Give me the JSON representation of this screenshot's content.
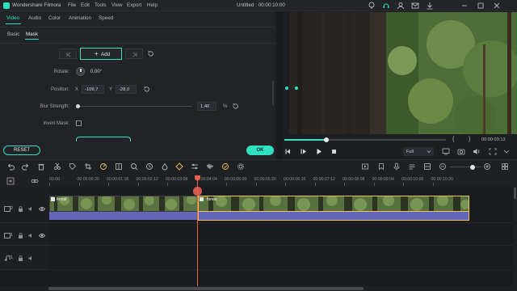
{
  "app": {
    "name": "Wondershare Filmora",
    "project_title": "Untitled : 00:00:10:00"
  },
  "menu": [
    "File",
    "Edit",
    "Tools",
    "View",
    "Export",
    "Help"
  ],
  "panel_tabs": [
    {
      "label": "Video",
      "active": true
    },
    {
      "label": "Audio",
      "active": false
    },
    {
      "label": "Color",
      "active": false
    },
    {
      "label": "Animation",
      "active": false
    },
    {
      "label": "Speed",
      "active": false
    }
  ],
  "sub_tabs": [
    {
      "label": "Basic",
      "active": false
    },
    {
      "label": "Mask",
      "active": true
    }
  ],
  "mask": {
    "add_label": "Add",
    "rotate_label": "Rotate:",
    "rotate_value": "0,00°",
    "position_label": "Position:",
    "x_label": "X",
    "x_value": "-109,7",
    "y_label": "Y",
    "y_value": "-28,0",
    "blur_label": "Blur Strength:",
    "blur_value": "1,40",
    "blur_unit": "%",
    "blur_fraction": 0.0,
    "invert_label": "Invert Mask:",
    "invert_checked": false
  },
  "actions": {
    "reset_label": "RESET",
    "ok_label": "OK"
  },
  "player": {
    "timecode": "00:00:03:13",
    "quality": "Full",
    "progress": 0.26,
    "bracket_in": "{",
    "bracket_out": "}"
  },
  "timeline": {
    "ruler_labels": [
      "00:00",
      "00:00:00:20",
      "00:00:01:16",
      "00:00:02:12",
      "00:00:03:08",
      "00:00:04:04",
      "00:00:05:00",
      "00:00:05:20",
      "00:00:06:16",
      "00:00:07:12",
      "00:00:08:08",
      "00:00:09:04",
      "00:00:10:00",
      "00:00:10:20"
    ],
    "tracks": [
      {
        "id": "video-2",
        "label": "2"
      },
      {
        "id": "video-1",
        "label": "1"
      },
      {
        "id": "audio-1",
        "label": "1"
      }
    ],
    "clips": [
      {
        "name": "forest"
      },
      {
        "name": "forest"
      }
    ]
  },
  "colors": {
    "accent": "#2fe0c3",
    "playhead": "#e8614f",
    "clip_border": "#e8c45a",
    "audio_bar": "#6566b8",
    "panel_bg": "#222327"
  }
}
